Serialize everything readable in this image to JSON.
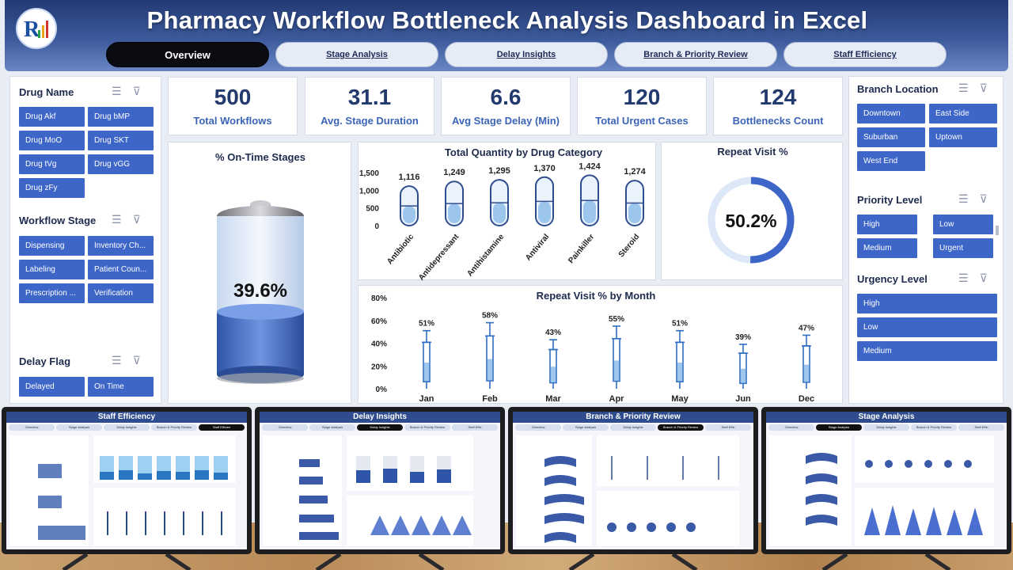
{
  "header": {
    "title": "Pharmacy Workflow Bottleneck Analysis Dashboard in Excel",
    "logo_icon": "rk-logo-icon"
  },
  "tabs": [
    {
      "label": "Overview",
      "active": true
    },
    {
      "label": "Stage Analysis",
      "active": false
    },
    {
      "label": "Delay Insights",
      "active": false
    },
    {
      "label": "Branch & Priority Review",
      "active": false
    },
    {
      "label": "Staff Efficiency",
      "active": false
    }
  ],
  "left_slicers": {
    "drug_name": {
      "title": "Drug Name",
      "items": [
        "Drug Akf",
        "Drug bMP",
        "Drug MoO",
        "Drug SKT",
        "Drug tVg",
        "Drug vGG",
        "Drug zFy"
      ]
    },
    "workflow_stage": {
      "title": "Workflow Stage",
      "items": [
        "Dispensing",
        "Inventory Ch...",
        "Labeling",
        "Patient Coun...",
        "Prescription ...",
        "Verification"
      ]
    },
    "delay_flag": {
      "title": "Delay Flag",
      "items": [
        "Delayed",
        "On Time"
      ]
    }
  },
  "right_slicers": {
    "branch": {
      "title": "Branch Location",
      "items": [
        "Downtown",
        "East Side",
        "Suburban",
        "Uptown",
        "West End"
      ]
    },
    "priority": {
      "title": "Priority Level",
      "items": [
        "High",
        "Low",
        "Medium",
        "Urgent"
      ]
    },
    "urgency": {
      "title": "Urgency Level",
      "items": [
        "High",
        "Low",
        "Medium"
      ]
    }
  },
  "kpis": [
    {
      "value": "500",
      "label": "Total Workflows"
    },
    {
      "value": "31.1",
      "label": "Avg. Stage Duration"
    },
    {
      "value": "6.6",
      "label": "Avg Stage Delay (Min)"
    },
    {
      "value": "120",
      "label": "Total Urgent Cases"
    },
    {
      "value": "124",
      "label": "Bottlenecks Count"
    }
  ],
  "ontime": {
    "title": "% On-Time Stages",
    "value_label": "39.6%",
    "fraction": 0.396
  },
  "repeat": {
    "title": "Repeat Visit %",
    "value_label": "50.2%",
    "fraction": 0.502
  },
  "colors": {
    "accent": "#3d66c8",
    "header": "#2f4c8e",
    "dark_tab": "#0b0c12"
  },
  "chart_data": [
    {
      "type": "bar",
      "title": "Total Quantity by Drug Category",
      "categories": [
        "Antibiotic",
        "Antidepressant",
        "Antihistamine",
        "Antiviral",
        "Painkiller",
        "Steroid"
      ],
      "values": [
        1116,
        1249,
        1295,
        1370,
        1424,
        1274
      ],
      "value_labels": [
        "1,116",
        "1,249",
        "1,295",
        "1,370",
        "1,424",
        "1,274"
      ],
      "ylim": [
        0,
        1500
      ],
      "yticks": [
        "0",
        "500",
        "1,000",
        "1,500"
      ]
    },
    {
      "type": "bar",
      "title": "Repeat Visit % by Month",
      "categories": [
        "Jan",
        "Feb",
        "Mar",
        "Apr",
        "May",
        "Jun",
        "Dec"
      ],
      "values": [
        51,
        58,
        43,
        55,
        51,
        39,
        47
      ],
      "value_labels": [
        "51%",
        "58%",
        "43%",
        "55%",
        "51%",
        "39%",
        "47%"
      ],
      "ylim": [
        0,
        80
      ],
      "yticks": [
        "0%",
        "20%",
        "40%",
        "60%",
        "80%"
      ]
    }
  ],
  "monitors": [
    {
      "title": "Staff Efficiency",
      "tabs": [
        "Overview",
        "Stage Analysis",
        "Delay Insights",
        "Branch & Priority Review",
        "Staff Efficien"
      ],
      "active": 4
    },
    {
      "title": "Delay Insights",
      "tabs": [
        "Overview",
        "Stage Analysis",
        "Delay Insights",
        "Branch & Priority Review",
        "Staff Effic"
      ],
      "active": 2
    },
    {
      "title": "Branch & Priority Review",
      "tabs": [
        "Overview",
        "Stage Analysis",
        "Delay Insights",
        "Branch & Priority Review",
        "Staff Effic"
      ],
      "active": 3
    },
    {
      "title": "Stage Analysis",
      "tabs": [
        "Overview",
        "Stage Analysis",
        "Delay Insights",
        "Branch & Priority Review",
        "Staff Effic"
      ],
      "active": 1
    }
  ]
}
